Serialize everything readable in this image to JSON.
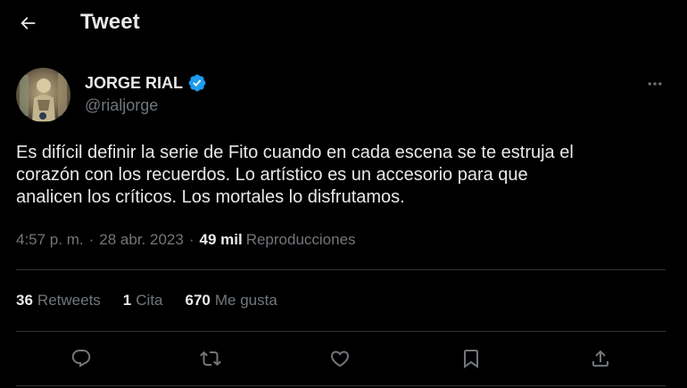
{
  "header": {
    "title": "Tweet",
    "back_icon": "arrow-left-icon"
  },
  "author": {
    "name": "JORGE RIAL",
    "handle": "@rialjorge",
    "verified": true,
    "verified_color": "#1d9bf0"
  },
  "tweet": {
    "lines": [
      "Es difícil definir la serie de Fito cuando en cada escena se te estruja el",
      "corazón con los recuerdos. Lo artístico es un accesorio para que",
      "analicen los críticos. Los mortales lo disfrutamos."
    ]
  },
  "meta": {
    "time": "4:57 p. m.",
    "separator": "·",
    "date": "28 abr. 2023",
    "views_count": "49 mil",
    "views_label": "Reproducciones"
  },
  "stats": {
    "retweets_count": "36",
    "retweets_label": "Retweets",
    "quotes_count": "1",
    "quotes_label": "Cita",
    "likes_count": "670",
    "likes_label": "Me gusta"
  },
  "actions": [
    "reply-icon",
    "retweet-icon",
    "like-icon",
    "bookmark-icon",
    "share-icon"
  ],
  "colors": {
    "background": "#000000",
    "text": "#e7e9ea",
    "secondary_text": "#71767b",
    "divider": "#2f3336",
    "accent": "#1d9bf0"
  }
}
